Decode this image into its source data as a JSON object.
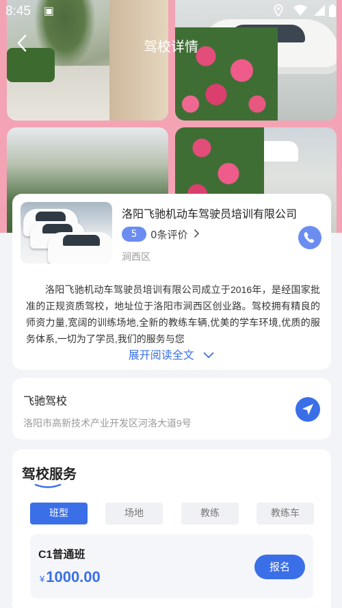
{
  "status_bar": {
    "time": "8:45"
  },
  "header": {
    "title": "驾校详情"
  },
  "school": {
    "name": "洛阳飞驰机动车驾驶员培训有限公司",
    "rating": "5",
    "reviews": "0条评价",
    "district": "涧西区",
    "intro": "洛阳飞驰机动车驾驶员培训有限公司成立于2016年，是经国家批准的正规资质驾校，地址位于洛阳市涧西区创业路。驾校拥有精良的师资力量,宽阔的训练场地,全新的教练车辆,优美的学车环境,优质的服务体系,一切为了学员,我们的服务与您",
    "expand_label": "展开阅读全文"
  },
  "location": {
    "name": "飞驰驾校",
    "address": "洛阳市高新技术产业开发区河洛大道9号"
  },
  "services": {
    "title": "驾校服务",
    "tabs": [
      "班型",
      "场地",
      "教练",
      "教练车"
    ],
    "active_tab": 0,
    "classes": [
      {
        "name": "C1普通班",
        "currency": "¥",
        "price": "1000.00",
        "button": "报名"
      }
    ]
  },
  "colors": {
    "accent": "#3a6fe8",
    "badge": "#6b8df2",
    "hero_bg": "#f4a3b4"
  }
}
